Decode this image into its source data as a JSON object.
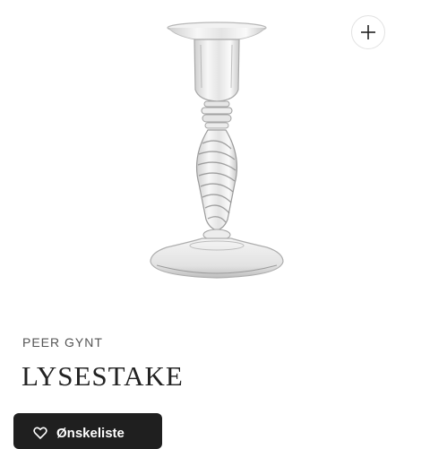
{
  "product": {
    "brand": "PEER GYNT",
    "title": "LYSESTAKE",
    "image_alt": "glass candlestick"
  },
  "actions": {
    "zoom_icon": "plus-icon",
    "primary_label": "Ønskeliste",
    "primary_icon": "heart-icon"
  },
  "colors": {
    "button_bg": "#1f1f1f",
    "text_primary": "#222222",
    "text_secondary": "#555555"
  }
}
